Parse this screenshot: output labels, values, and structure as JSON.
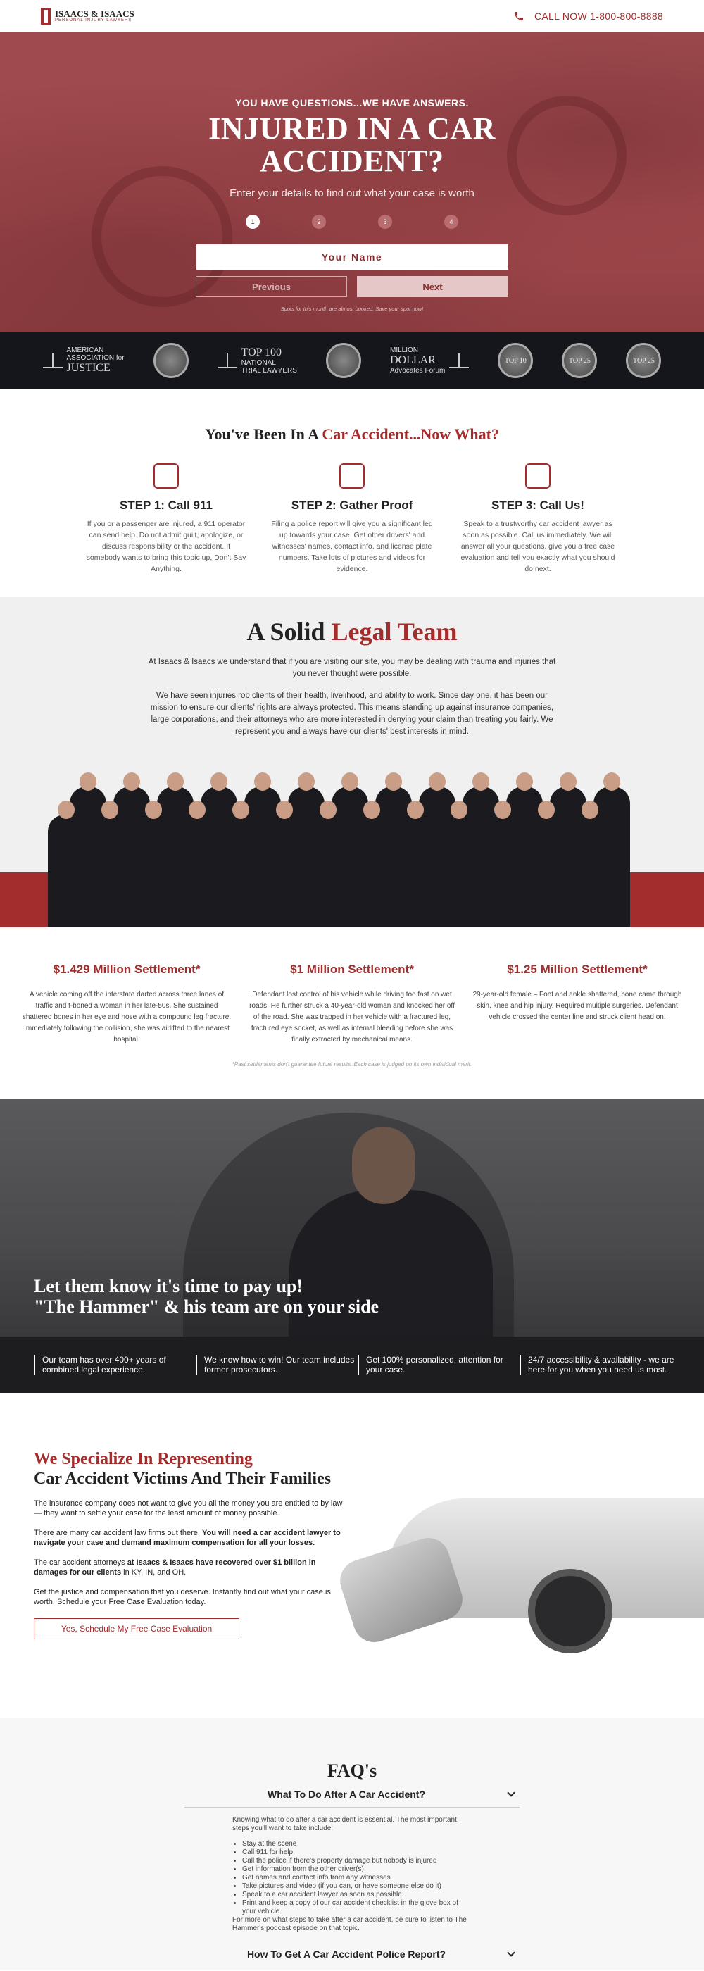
{
  "header": {
    "logo_name": "ISAACS & ISAACS",
    "logo_tagline": "PERSONAL INJURY LAWYERS",
    "call_label": "CALL NOW 1-800-800-8888"
  },
  "hero": {
    "kicker": "YOU HAVE QUESTIONS...WE HAVE ANSWERS.",
    "title_line1": "INJURED IN A CAR",
    "title_line2": "ACCIDENT?",
    "subtitle": "Enter your details to find out what your case is worth",
    "steps": [
      "1",
      "2",
      "3",
      "4"
    ],
    "active_step": 1,
    "name_placeholder": "Your Name",
    "prev_label": "Previous",
    "next_label": "Next",
    "note": "Spots for this month are almost booked. Save your spot now!"
  },
  "badges": [
    {
      "line1": "AMERICAN",
      "line2": "ASSOCIATION for",
      "line3": "JUSTICE",
      "icon": "scales-icon"
    },
    {
      "circle": "",
      "icon": "seal-badge-icon"
    },
    {
      "line1": "TOP 100",
      "line2": "NATIONAL",
      "line3": "TRIAL LAWYERS",
      "icon": "scales-icon"
    },
    {
      "circle": "",
      "icon": "seal-badge-icon"
    },
    {
      "line1": "MILLION",
      "line2": "DOLLAR",
      "line3": "Advocates Forum",
      "icon": "scales-icon"
    },
    {
      "circle": "TOP 10",
      "icon": "medal-icon"
    },
    {
      "circle": "TOP 25",
      "icon": "medal-icon"
    },
    {
      "circle": "TOP 25",
      "icon": "medal-icon"
    }
  ],
  "now_what": {
    "title_part1": "You've Been In A ",
    "title_part2": "Car Accident...Now What?",
    "columns": [
      {
        "title": "STEP 1: Call 911",
        "text": "If you or a passenger are injured, a 911 operator can send help. Do not admit guilt, apologize, or discuss responsibility or the accident. If somebody wants to bring this topic up, Don't Say Anything."
      },
      {
        "title": "STEP 2: Gather Proof",
        "text": "Filing a police report will give you a significant leg up towards your case. Get other drivers' and witnesses' names, contact info, and license plate numbers. Take lots of pictures and videos for evidence."
      },
      {
        "title": "STEP 3: Call Us!",
        "text": "Speak to a trustworthy car accident lawyer as soon as possible. Call us immediately. We will answer all your questions, give you a free case evaluation and tell you exactly what you should do next."
      }
    ]
  },
  "legal_team": {
    "title_part1": "A Solid ",
    "title_part2": "Legal Team",
    "para1": "At Isaacs & Isaacs we understand that if you are visiting our site, you may be dealing with trauma and injuries that you never thought were possible.",
    "para2": "We have seen injuries rob clients of their health, livelihood, and ability to work. Since day one, it has been our mission to ensure our clients' rights are always protected. This means standing up against insurance companies, large corporations, and their attorneys who are more interested in denying your claim than treating you fairly. We represent you and always have our clients' best interests in mind."
  },
  "settlements": {
    "items": [
      {
        "title": "$1.429 Million Settlement*",
        "text": "A vehicle coming off the interstate darted across three lanes of traffic and t-boned a woman in her late-50s. She sustained shattered bones in her eye and nose with a compound leg fracture. Immediately following the collision, she was airlifted to the nearest hospital."
      },
      {
        "title": "$1 Million Settlement*",
        "text": "Defendant lost control of his vehicle while driving too fast on wet roads. He further struck a 40-year-old woman and knocked her off of the road. She was trapped in her vehicle with a fractured leg, fractured eye socket, as well as internal bleeding before she was finally extracted by mechanical means."
      },
      {
        "title": "$1.25 Million Settlement*",
        "text": "29-year-old female – Foot and ankle shattered, bone came through skin, knee and hip injury. Required multiple surgeries. Defendant vehicle crossed the center line and struck client head on."
      }
    ],
    "disclaimer": "*Past settlements don't guarantee future results. Each case is judged on its own individual merit."
  },
  "hammer": {
    "line1": "Let them know it's time to pay up!",
    "line2": "\"The Hammer\" & his team are on your side",
    "bar_items": [
      "Our team has over 400+ years of combined legal experience.",
      "We know how to win! Our team includes former prosecutors.",
      "Get 100% personalized, attention for your case.",
      "24/7 accessibility & availability - we are here for you when you need us most."
    ]
  },
  "specialize": {
    "title_red": "We Specialize In Representing",
    "title_black": "Car Accident Victims And Their Families",
    "p1": "The insurance company does not want to give you all the money you are entitled to by law — they want to settle your case for the least amount of money possible.",
    "p2_normal": "There are many car accident law firms out there. ",
    "p2_bold": "You will need a car accident lawyer to navigate your case and demand maximum compensation for all your losses.",
    "p3_normal1": "The car accident attorneys ",
    "p3_bold": "at Isaacs & Isaacs have recovered over $1 billion in damages for our clients",
    "p3_normal2": " in KY, IN, and OH.",
    "p4": "Get the justice and compensation that you deserve. Instantly find out what your case is worth. Schedule your Free Case Evaluation today.",
    "cta": "Yes, Schedule My Free Case Evaluation"
  },
  "faq": {
    "title": "FAQ's",
    "q1": "What To Do After A Car Accident?",
    "a1_intro": "Knowing what to do after a car accident is essential. The most important steps you'll want to take include:",
    "a1_list": [
      "Stay at the scene",
      "Call 911 for help",
      "Call the police if there's property damage but nobody is injured",
      "Get information from the other driver(s)",
      "Get names and contact info from any witnesses",
      "Take pictures and video (if you can, or have someone else do it)",
      "Speak to a car accident lawyer as soon as possible",
      "Print and keep a copy of our car accident checklist in the glove box of your vehicle."
    ],
    "a1_outro": "For more on what steps to take after a car accident, be sure to listen to The Hammer's podcast episode on that topic.",
    "q2": "How To Get A Car Accident Police Report?"
  },
  "colors": {
    "brand_red": "#a32c2c",
    "dark": "#15161c"
  }
}
